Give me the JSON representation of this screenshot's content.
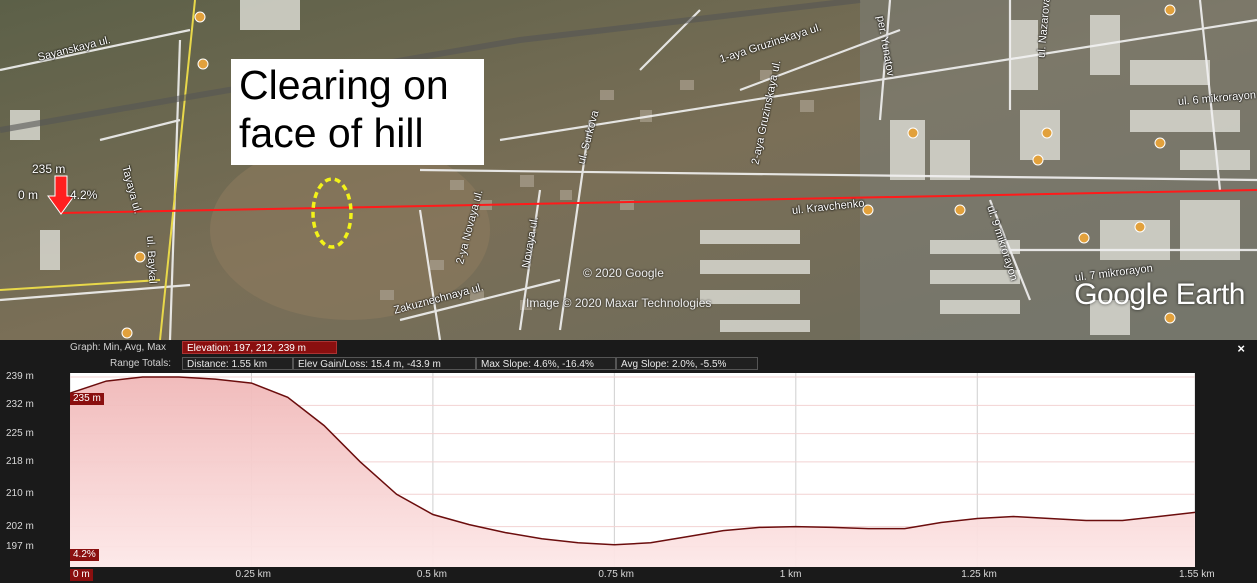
{
  "map": {
    "annotation_line1": "Clearing on",
    "annotation_line2": "face of hill",
    "marker_elevation": "235 m",
    "marker_distance": "0 m",
    "marker_slope": "4.2%",
    "copyright_google": "© 2020 Google",
    "copyright_imagery": "Image © 2020 Maxar Technologies",
    "brand": "Google Earth",
    "streets": [
      "Sayanskaya ul.",
      "1-aya Gruzinskaya ul.",
      "per. Yunatov",
      "ul. Nazarova",
      "ul. 6 mikrorayon",
      "Tayaya ul.",
      "ul. Surkova",
      "2-aya Gruzinskaya ul.",
      "ul. Kravchenko",
      "ul. 9 mikrorayon",
      "2-ya Novaya ul.",
      "Novaya ul.",
      "ul. 7 mikrorayon",
      "ul. Baykal",
      "Zakuznechnaya ul."
    ]
  },
  "graph": {
    "header_label": "Graph: Min, Avg, Max",
    "elevation_box": "Elevation: 197, 212, 239 m",
    "range_totals_label": "Range Totals:",
    "distance_box": "Distance: 1.55 km",
    "elev_gain_box": "Elev Gain/Loss: 15.4 m, -43.9 m",
    "max_slope_box": "Max Slope: 4.6%, -16.4%",
    "avg_slope_box": "Avg Slope: 2.0%, -5.5%",
    "close_icon": "×",
    "current_elevation_tag": "235 m",
    "current_slope_tag": "4.2%",
    "current_distance_tag": "0 m"
  },
  "chart_data": {
    "type": "area",
    "title": "",
    "xlabel": "",
    "ylabel": "",
    "x_unit": "km",
    "y_unit": "m",
    "xlim": [
      0,
      1.55
    ],
    "ylim": [
      192,
      240
    ],
    "y_ticks": [
      "239 m",
      "232 m",
      "225 m",
      "218 m",
      "210 m",
      "202 m",
      "197 m"
    ],
    "y_tick_values": [
      239,
      232,
      225,
      218,
      210,
      202,
      197
    ],
    "x_ticks": [
      "0 m",
      "0.25 km",
      "0.5 km",
      "0.75 km",
      "1 km",
      "1.25 km",
      "1.55 km"
    ],
    "x_tick_values": [
      0,
      0.25,
      0.5,
      0.75,
      1.0,
      1.25,
      1.55
    ],
    "grid": true,
    "series": [
      {
        "x": [
          0,
          0.05,
          0.1,
          0.15,
          0.2,
          0.25,
          0.3,
          0.35,
          0.4,
          0.45,
          0.5,
          0.55,
          0.6,
          0.65,
          0.7,
          0.75,
          0.8,
          0.85,
          0.9,
          0.95,
          1.0,
          1.05,
          1.1,
          1.15,
          1.2,
          1.25,
          1.3,
          1.35,
          1.4,
          1.45,
          1.5,
          1.55
        ],
        "y": [
          235,
          238,
          239,
          239,
          238.5,
          237.5,
          234,
          227,
          218,
          210,
          205,
          202.5,
          200.5,
          199,
          198,
          197.5,
          198,
          199.5,
          201,
          201.8,
          202,
          201.8,
          201.5,
          201.5,
          203,
          204,
          204.5,
          204,
          203.5,
          203.5,
          204.5,
          205.5
        ]
      }
    ]
  }
}
